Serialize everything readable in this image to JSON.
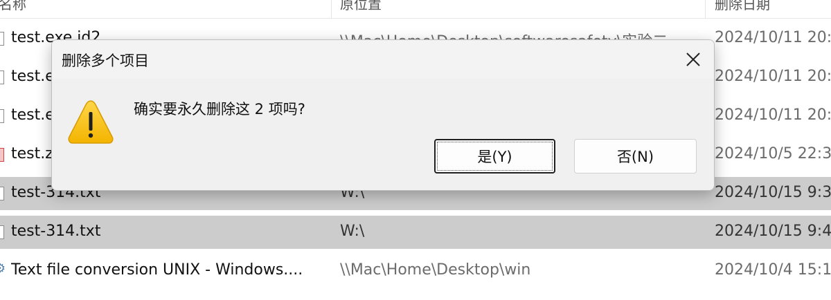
{
  "list": {
    "headers": {
      "name": "名称",
      "location": "原位置",
      "date": "删除日期"
    },
    "rows": [
      {
        "name": "test.exe.id2",
        "location": "\\\\Mac\\Home\\Desktop\\softwaresafety\\实验二",
        "date": "2024/10/11 20:",
        "icon": "file-icon",
        "selected": false
      },
      {
        "name": "test.exe",
        "location": "",
        "date": "2024/10/11 20:",
        "icon": "file-icon",
        "selected": false
      },
      {
        "name": "test.exe",
        "location": "",
        "date": "2024/10/11 20:",
        "icon": "file-icon",
        "selected": false
      },
      {
        "name": "test.zip",
        "location": "",
        "date": "2024/10/5 22:3",
        "icon": "zip-icon",
        "selected": false
      },
      {
        "name": "test-314.txt",
        "location": "W:\\",
        "date": "2024/10/15 9:3",
        "icon": "file-icon",
        "selected": true
      },
      {
        "name": "test-314.txt",
        "location": "W:\\",
        "date": "2024/10/15 9:4",
        "icon": "file-icon",
        "selected": true
      },
      {
        "name": "Text file conversion UNIX - Windows....",
        "location": "\\\\Mac\\Home\\Desktop\\win",
        "date": "2024/10/4 15:1",
        "icon": "gear-icon",
        "selected": false
      }
    ]
  },
  "dialog": {
    "title": "删除多个项目",
    "message": "确实要永久删除这 2 项吗?",
    "icon": "warning-icon",
    "yes_label": "是(Y)",
    "no_label": "否(N)",
    "close_icon": "close-icon"
  }
}
